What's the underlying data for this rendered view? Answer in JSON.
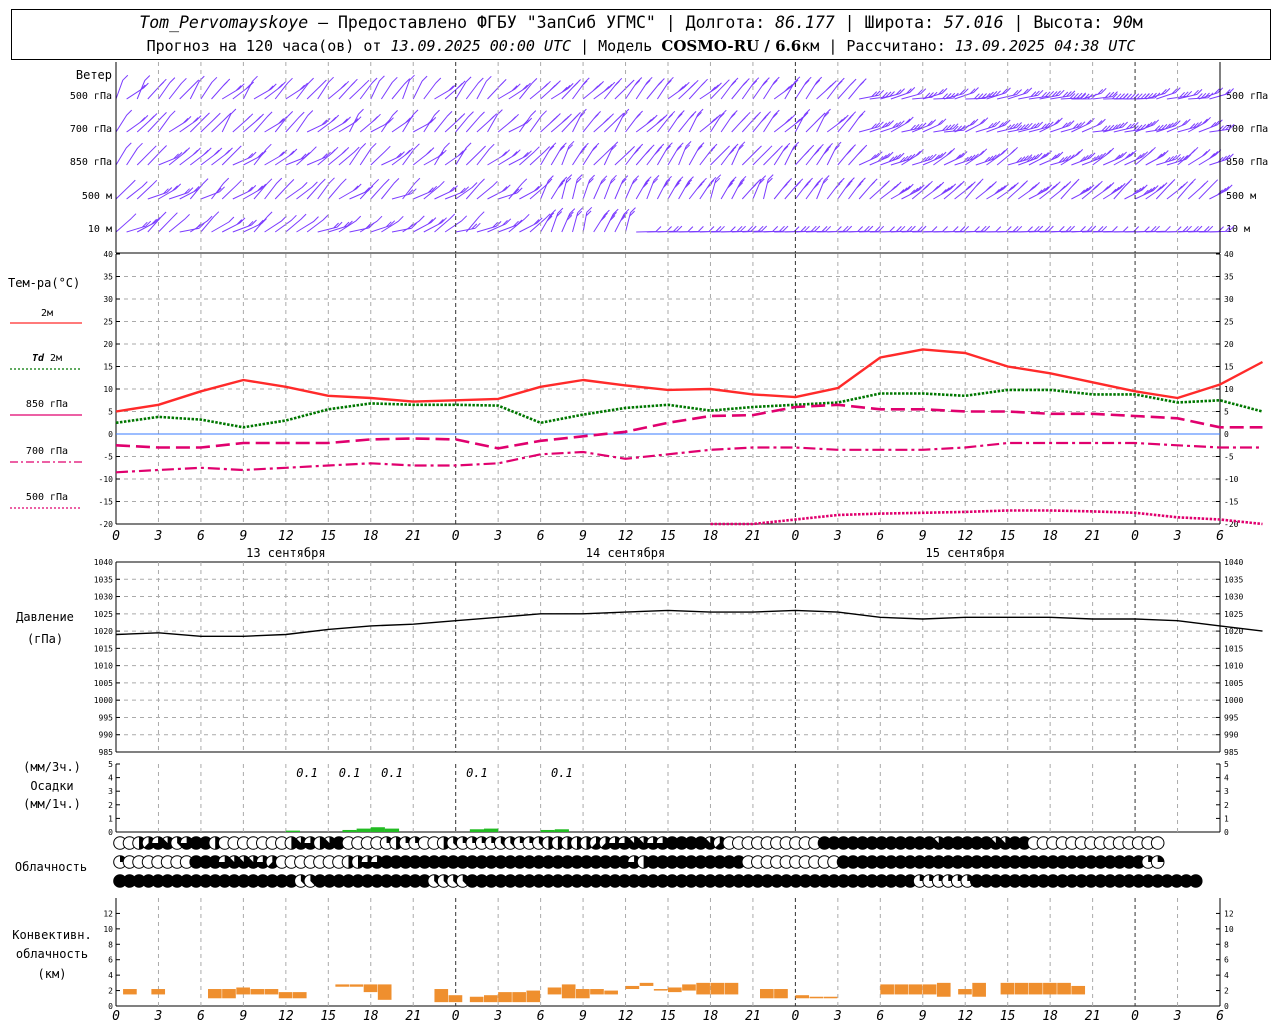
{
  "header": {
    "station": "Tom_Pervomayskoye",
    "provided_prefix": "– Предоставлено ФГБУ \"ЗапСиб УГМС\"",
    "lon_label": "Долгота:",
    "lon": "86.177",
    "lat_label": "Широта:",
    "lat": "57.016",
    "alt_label": "Высота:",
    "alt": "90",
    "alt_unit": "м",
    "forecast_label": "Прогноз на 120 часа(ов) от",
    "forecast_start": "13.09.2025 00:00 UTC",
    "model_label": "Модель",
    "model": "COSMO-RU / 6.6",
    "model_unit": "км",
    "calc_label": "Рассчитано:",
    "calc_time": "13.09.2025 04:38 UTC"
  },
  "hour_ticks": [
    "0",
    "3",
    "6",
    "9",
    "12",
    "15",
    "18",
    "21",
    "0",
    "3",
    "6",
    "9",
    "12",
    "15",
    "18",
    "21",
    "0",
    "3",
    "6",
    "9",
    "12",
    "15",
    "18",
    "21",
    "0",
    "3",
    "6"
  ],
  "day_labels": [
    "13 сентября",
    "14 сентября",
    "15 сентября"
  ],
  "wind_panel": {
    "title": "Ветер",
    "levels": [
      {
        "label": "500 гПа"
      },
      {
        "label": "700 гПа"
      },
      {
        "label": "850 гПа"
      },
      {
        "label": "500 м"
      },
      {
        "label": "10  м"
      }
    ]
  },
  "temp_legend": {
    "title": "Тем-ра(°С)",
    "items": [
      {
        "label": "2м",
        "color": "#ff2a2a",
        "style": "solid"
      },
      {
        "label_bold": "Td",
        "label": "2м",
        "color": "#007700",
        "style": "dotted"
      },
      {
        "label": "850 гПа",
        "color": "#e0006e",
        "style": "dashed"
      },
      {
        "label": "700 гПа",
        "color": "#e0006e",
        "style": "dashdot"
      },
      {
        "label": "500 гПа",
        "color": "#e0006e",
        "style": "densedot"
      }
    ]
  },
  "pressure_labels": {
    "title": "Давление",
    "unit": "(гПа)"
  },
  "precip_labels": {
    "unit3h": "(мм/3ч.)",
    "title": "Осадки",
    "unit1h": "(мм/1ч.)"
  },
  "cloud_label": "Облачность",
  "conv_labels": {
    "l1": "Конвективн.",
    "l2": "облачность",
    "l3": "(км)"
  },
  "chart_data": [
    {
      "type": "line",
      "name": "temperature",
      "x_hours": [
        0,
        3,
        6,
        9,
        12,
        15,
        18,
        21,
        24,
        27,
        30,
        33,
        36,
        39,
        42,
        45,
        48,
        51,
        54,
        57,
        60,
        63,
        66,
        69,
        72,
        75,
        78
      ],
      "ylim": [
        -20,
        40
      ],
      "yticks": [
        -20,
        -15,
        -10,
        -5,
        0,
        5,
        10,
        15,
        20,
        25,
        30,
        35,
        40
      ],
      "series": [
        {
          "name": "2м",
          "color": "#ff2a2a",
          "values": [
            5,
            6.5,
            9.5,
            12,
            10.5,
            8.5,
            8,
            7.2,
            7.5,
            7.8,
            10.5,
            12,
            10.8,
            9.8,
            10,
            8.8,
            8.2,
            10.2,
            17,
            18.8,
            18,
            15,
            13.5,
            11.5,
            9.5,
            8,
            11,
            16
          ]
        },
        {
          "name": "Td 2м",
          "color": "#007700",
          "values": [
            2.5,
            3.8,
            3.2,
            1.5,
            3,
            5.5,
            6.8,
            6.5,
            6.5,
            6.3,
            2.5,
            4.3,
            5.8,
            6.5,
            5.2,
            6,
            6.5,
            7,
            9,
            9,
            8.5,
            9.8,
            9.8,
            8.8,
            8.8,
            7,
            7.5,
            5
          ]
        },
        {
          "name": "850 гПа",
          "color": "#e0006e",
          "values": [
            -2.5,
            -3,
            -3,
            -2,
            -2,
            -2,
            -1.2,
            -1,
            -1.2,
            -3.2,
            -1.5,
            -0.5,
            0.5,
            2.5,
            4,
            4.2,
            6,
            6.5,
            5.5,
            5.5,
            5,
            5,
            4.5,
            4.5,
            4,
            3.5,
            1.5,
            1.5
          ]
        },
        {
          "name": "700 гПа",
          "color": "#e0006e",
          "values": [
            -8.5,
            -8,
            -7.5,
            -8,
            -7.5,
            -7,
            -6.5,
            -7,
            -7,
            -6.5,
            -4.5,
            -4,
            -5.5,
            -4.5,
            -3.5,
            -3,
            -3,
            -3.5,
            -3.5,
            -3.5,
            -3,
            -2,
            -2,
            -2,
            -2,
            -2.5,
            -3,
            -3
          ]
        },
        {
          "name": "500 гПа",
          "color": "#e0006e",
          "values": [
            null,
            null,
            null,
            null,
            null,
            null,
            null,
            null,
            null,
            null,
            null,
            null,
            null,
            null,
            -20,
            -20,
            -19,
            -18,
            -17.7,
            -17.5,
            -17.3,
            -17,
            -17,
            -17.2,
            -17.5,
            -18.5,
            -19,
            -20
          ]
        }
      ]
    },
    {
      "type": "line",
      "name": "pressure",
      "x_hours": [
        0,
        3,
        6,
        9,
        12,
        15,
        18,
        21,
        24,
        27,
        30,
        33,
        36,
        39,
        42,
        45,
        48,
        51,
        54,
        57,
        60,
        63,
        66,
        69,
        72,
        75,
        78
      ],
      "ylim": [
        985,
        1040
      ],
      "yticks": [
        985,
        990,
        995,
        1000,
        1005,
        1010,
        1015,
        1020,
        1025,
        1030,
        1035,
        1040
      ],
      "series": [
        {
          "name": "Давление",
          "color": "#000000",
          "values": [
            1019,
            1019.5,
            1018.5,
            1018.5,
            1019,
            1020.5,
            1021.5,
            1022,
            1023,
            1024,
            1025,
            1025,
            1025.5,
            1026,
            1025.5,
            1025.5,
            1026,
            1025.5,
            1024,
            1023.5,
            1024,
            1024,
            1024,
            1023.5,
            1023.5,
            1023,
            1021.5,
            1020
          ]
        }
      ]
    },
    {
      "type": "bar",
      "name": "precipitation",
      "ylim": [
        0,
        5
      ],
      "yticks": [
        0,
        1,
        2,
        3,
        4,
        5
      ],
      "labels": [
        {
          "hour": 13.5,
          "text": "0.1"
        },
        {
          "hour": 16.5,
          "text": "0.1"
        },
        {
          "hour": 19.5,
          "text": "0.1"
        },
        {
          "hour": 25.5,
          "text": "0.1"
        },
        {
          "hour": 31.5,
          "text": "0.1"
        }
      ],
      "bars": [
        {
          "from": 12,
          "to": 13,
          "value": 0.1
        },
        {
          "from": 16,
          "to": 17,
          "value": 0.15
        },
        {
          "from": 17,
          "to": 18,
          "value": 0.25
        },
        {
          "from": 18,
          "to": 19,
          "value": 0.35
        },
        {
          "from": 19,
          "to": 20,
          "value": 0.25
        },
        {
          "from": 25,
          "to": 26,
          "value": 0.2
        },
        {
          "from": 26,
          "to": 27,
          "value": 0.25
        },
        {
          "from": 30,
          "to": 31,
          "value": 0.15
        },
        {
          "from": 31,
          "to": 32,
          "value": 0.2
        }
      ]
    },
    {
      "type": "bar",
      "name": "convective_clouds",
      "ylim": [
        0,
        14
      ],
      "yticks": [
        0,
        2,
        4,
        6,
        8,
        10,
        12
      ],
      "bars": [
        {
          "from": 0.5,
          "to": 1.5,
          "low": 1.5,
          "high": 2.2
        },
        {
          "from": 2.5,
          "to": 3.5,
          "low": 1.5,
          "high": 2.2
        },
        {
          "from": 6.5,
          "to": 7.5,
          "low": 1,
          "high": 2.2
        },
        {
          "from": 7.5,
          "to": 8.5,
          "low": 1,
          "high": 2.2
        },
        {
          "from": 8.5,
          "to": 9.5,
          "low": 1.5,
          "high": 2.4
        },
        {
          "from": 9.5,
          "to": 10.5,
          "low": 1.5,
          "high": 2.2
        },
        {
          "from": 10.5,
          "to": 11.5,
          "low": 1.5,
          "high": 2.2
        },
        {
          "from": 11.5,
          "to": 12.5,
          "low": 1,
          "high": 1.8
        },
        {
          "from": 12.5,
          "to": 13.5,
          "low": 1,
          "high": 1.8
        },
        {
          "from": 15.5,
          "to": 16.5,
          "low": 2.5,
          "high": 2.8
        },
        {
          "from": 16.5,
          "to": 17.5,
          "low": 2.5,
          "high": 2.8
        },
        {
          "from": 17.5,
          "to": 18.5,
          "low": 1.8,
          "high": 2.8
        },
        {
          "from": 18.5,
          "to": 19.5,
          "low": 0.8,
          "high": 2.8
        },
        {
          "from": 22.5,
          "to": 23.5,
          "low": 0.5,
          "high": 2.2
        },
        {
          "from": 23.5,
          "to": 24.5,
          "low": 0.5,
          "high": 1.4
        },
        {
          "from": 25,
          "to": 26,
          "low": 0.5,
          "high": 1.2
        },
        {
          "from": 26,
          "to": 27,
          "low": 0.5,
          "high": 1.4
        },
        {
          "from": 27,
          "to": 28,
          "low": 0.5,
          "high": 1.8
        },
        {
          "from": 28,
          "to": 29,
          "low": 0.5,
          "high": 1.8
        },
        {
          "from": 29,
          "to": 30,
          "low": 0.5,
          "high": 2
        },
        {
          "from": 30.5,
          "to": 31.5,
          "low": 1.5,
          "high": 2.4
        },
        {
          "from": 31.5,
          "to": 32.5,
          "low": 1,
          "high": 2.8
        },
        {
          "from": 32.5,
          "to": 33.5,
          "low": 1,
          "high": 2.2
        },
        {
          "from": 33.5,
          "to": 34.5,
          "low": 1.5,
          "high": 2.2
        },
        {
          "from": 34.5,
          "to": 35.5,
          "low": 1.5,
          "high": 2
        },
        {
          "from": 36,
          "to": 37,
          "low": 2.2,
          "high": 2.6
        },
        {
          "from": 37,
          "to": 38,
          "low": 2.6,
          "high": 3
        },
        {
          "from": 38,
          "to": 39,
          "low": 2,
          "high": 2.2
        },
        {
          "from": 39,
          "to": 40,
          "low": 1.8,
          "high": 2.4
        },
        {
          "from": 40,
          "to": 41,
          "low": 2,
          "high": 2.8
        },
        {
          "from": 41,
          "to": 42,
          "low": 1.5,
          "high": 3
        },
        {
          "from": 42,
          "to": 43,
          "low": 1.5,
          "high": 3
        },
        {
          "from": 43,
          "to": 44,
          "low": 1.5,
          "high": 3
        },
        {
          "from": 45.5,
          "to": 46.5,
          "low": 1,
          "high": 2.2
        },
        {
          "from": 46.5,
          "to": 47.5,
          "low": 1,
          "high": 2.2
        },
        {
          "from": 48,
          "to": 49,
          "low": 1,
          "high": 1.4
        },
        {
          "from": 49,
          "to": 50,
          "low": 1,
          "high": 1.2
        },
        {
          "from": 50,
          "to": 51,
          "low": 1,
          "high": 1.2
        },
        {
          "from": 54,
          "to": 55,
          "low": 1.5,
          "high": 2.8
        },
        {
          "from": 55,
          "to": 56,
          "low": 1.5,
          "high": 2.8
        },
        {
          "from": 56,
          "to": 57,
          "low": 1.5,
          "high": 2.8
        },
        {
          "from": 57,
          "to": 58,
          "low": 1.5,
          "high": 2.8
        },
        {
          "from": 58,
          "to": 59,
          "low": 1.2,
          "high": 3
        },
        {
          "from": 59.5,
          "to": 60.5,
          "low": 1.5,
          "high": 2.2
        },
        {
          "from": 60.5,
          "to": 61.5,
          "low": 1.2,
          "high": 3
        },
        {
          "from": 62.5,
          "to": 63.5,
          "low": 1.5,
          "high": 3
        },
        {
          "from": 63.5,
          "to": 64.5,
          "low": 1.5,
          "high": 3
        },
        {
          "from": 64.5,
          "to": 65.5,
          "low": 1.5,
          "high": 3
        },
        {
          "from": 65.5,
          "to": 66.5,
          "low": 1.5,
          "high": 3
        },
        {
          "from": 66.5,
          "to": 67.5,
          "low": 1.5,
          "high": 3
        },
        {
          "from": 67.5,
          "to": 68.5,
          "low": 1.5,
          "high": 2.6
        }
      ]
    },
    {
      "type": "table",
      "name": "cloud_cover_octas",
      "rows_top_to_bottom": [
        "upper",
        "middle",
        "lower"
      ],
      "octas": [
        [
          0,
          0,
          4,
          5,
          6,
          7,
          3,
          6,
          8,
          8,
          4,
          0,
          0,
          0,
          0,
          0,
          0,
          0,
          4,
          7,
          6,
          4,
          7,
          8,
          0,
          0,
          0,
          0,
          2,
          4,
          2,
          2,
          0,
          0,
          4,
          3,
          2,
          2,
          2,
          2,
          3,
          3,
          2,
          2,
          3,
          4,
          4,
          4,
          4,
          4,
          5,
          5,
          6,
          6,
          7,
          7,
          6,
          6,
          8,
          8,
          8,
          8,
          7,
          5,
          0,
          0,
          0,
          0,
          0,
          0,
          0,
          0,
          0,
          0,
          8,
          8,
          8,
          8,
          8,
          8,
          8,
          8,
          8,
          8,
          8,
          8,
          7,
          8,
          8,
          8,
          8,
          8,
          7,
          7,
          8,
          8,
          0,
          0,
          0,
          0,
          0,
          0,
          0,
          0,
          0,
          0,
          0,
          0,
          0,
          0
        ],
        [
          2,
          0,
          0,
          0,
          0,
          0,
          0,
          0,
          8,
          8,
          8,
          6,
          7,
          7,
          7,
          6,
          5,
          0,
          0,
          0,
          0,
          0,
          0,
          0,
          4,
          4,
          6,
          6,
          8,
          8,
          8,
          8,
          8,
          8,
          8,
          8,
          8,
          8,
          8,
          8,
          8,
          8,
          8,
          8,
          8,
          8,
          8,
          8,
          8,
          8,
          8,
          8,
          8,
          8,
          6,
          4,
          8,
          8,
          8,
          8,
          8,
          8,
          8,
          8,
          8,
          8,
          0,
          0,
          0,
          0,
          0,
          0,
          0,
          0,
          0,
          0,
          8,
          8,
          8,
          8,
          8,
          8,
          8,
          8,
          8,
          8,
          8,
          8,
          8,
          8,
          8,
          8,
          8,
          8,
          8,
          8,
          8,
          8,
          8,
          8,
          8,
          8,
          8,
          8,
          8,
          8,
          8,
          8,
          2,
          2
        ],
        [
          8,
          8,
          8,
          8,
          8,
          8,
          8,
          8,
          8,
          8,
          8,
          8,
          8,
          8,
          8,
          8,
          8,
          8,
          8,
          3,
          3,
          8,
          8,
          8,
          8,
          8,
          8,
          8,
          8,
          8,
          8,
          8,
          8,
          3,
          3,
          3,
          3,
          8,
          8,
          8,
          8,
          8,
          8,
          8,
          8,
          8,
          8,
          8,
          8,
          8,
          8,
          8,
          8,
          8,
          8,
          8,
          8,
          8,
          8,
          8,
          8,
          8,
          8,
          8,
          8,
          8,
          8,
          8,
          8,
          8,
          8,
          8,
          8,
          8,
          8,
          8,
          8,
          8,
          8,
          8,
          8,
          8,
          8,
          8,
          2,
          2,
          2,
          2,
          2,
          2,
          8,
          8,
          8,
          8,
          8,
          8,
          8,
          8,
          8,
          8,
          8,
          8,
          8,
          8,
          8,
          8,
          8,
          8,
          8,
          8,
          8,
          8,
          8,
          8
        ]
      ]
    }
  ]
}
